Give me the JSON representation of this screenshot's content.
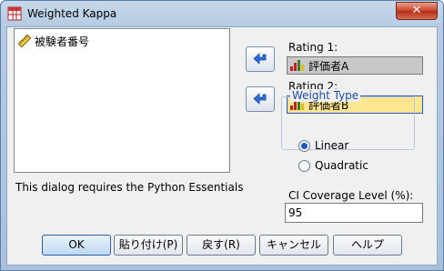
{
  "window": {
    "title": "Weighted Kappa",
    "close_label": "✕"
  },
  "variables_list": {
    "items": [
      {
        "label": "被験者番号",
        "icon": "ruler-scale-icon"
      }
    ]
  },
  "note": "This dialog requires the Python Essentials",
  "rating1": {
    "label": "Rating 1:",
    "value": "評価者A",
    "icon": "nominal-bar-icon"
  },
  "rating2": {
    "label": "Rating 2:",
    "value": "評価者B",
    "icon": "nominal-bar-icon"
  },
  "weight_type": {
    "legend": "Weight Type",
    "options": [
      {
        "label": "Linear",
        "selected": true
      },
      {
        "label": "Quadratic",
        "selected": false
      }
    ]
  },
  "ci": {
    "label": "CI Coverage Level (%):",
    "value": "95"
  },
  "buttons": {
    "ok": "OK",
    "paste": "貼り付け(P)",
    "reset": "戻す(R)",
    "cancel": "キャンセル",
    "help": "ヘルプ"
  },
  "colors": {
    "title_gradient": "#b6cbe2",
    "accent": "#1f57c8",
    "target_b_bg": "#fde68f",
    "target_a_bg": "#c9c9c9"
  }
}
